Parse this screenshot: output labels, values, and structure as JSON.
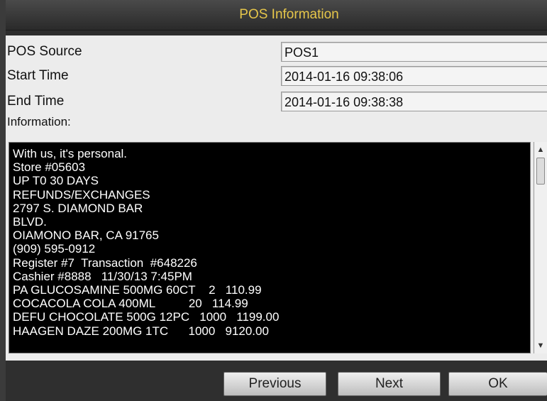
{
  "dialog": {
    "title": "POS Information"
  },
  "fields": {
    "pos_source": {
      "label": "POS Source",
      "value": "POS1"
    },
    "start_time": {
      "label": "Start Time",
      "value": "2014-01-16 09:38:06"
    },
    "end_time": {
      "label": "End Time",
      "value": "2014-01-16 09:38:38"
    }
  },
  "information": {
    "label": "Information:",
    "text": "With us, it's personal.\nStore #05603\nUP T0 30 DAYS\nREFUNDS/EXCHANGES\n2797 S. DIAMOND BAR\nBLVD.\nOIAMONO BAR, CA 91765\n(909) 595-0912\nRegister #7  Transaction  #648226\nCashier #8888   11/30/13 7:45PM\nPA GLUCOSAMINE 500MG 60CT    2   110.99\nCOCACOLA COLA 400ML          20   114.99\nDEFU CHOCOLATE 500G 12PC   1000   1199.00\nHAAGEN DAZE 200MG 1TC      1000   9120.00"
  },
  "buttons": {
    "previous": "Previous",
    "next": "Next",
    "ok": "OK"
  },
  "scrollbar": {
    "up_icon": "▲",
    "down_icon": "▼"
  }
}
